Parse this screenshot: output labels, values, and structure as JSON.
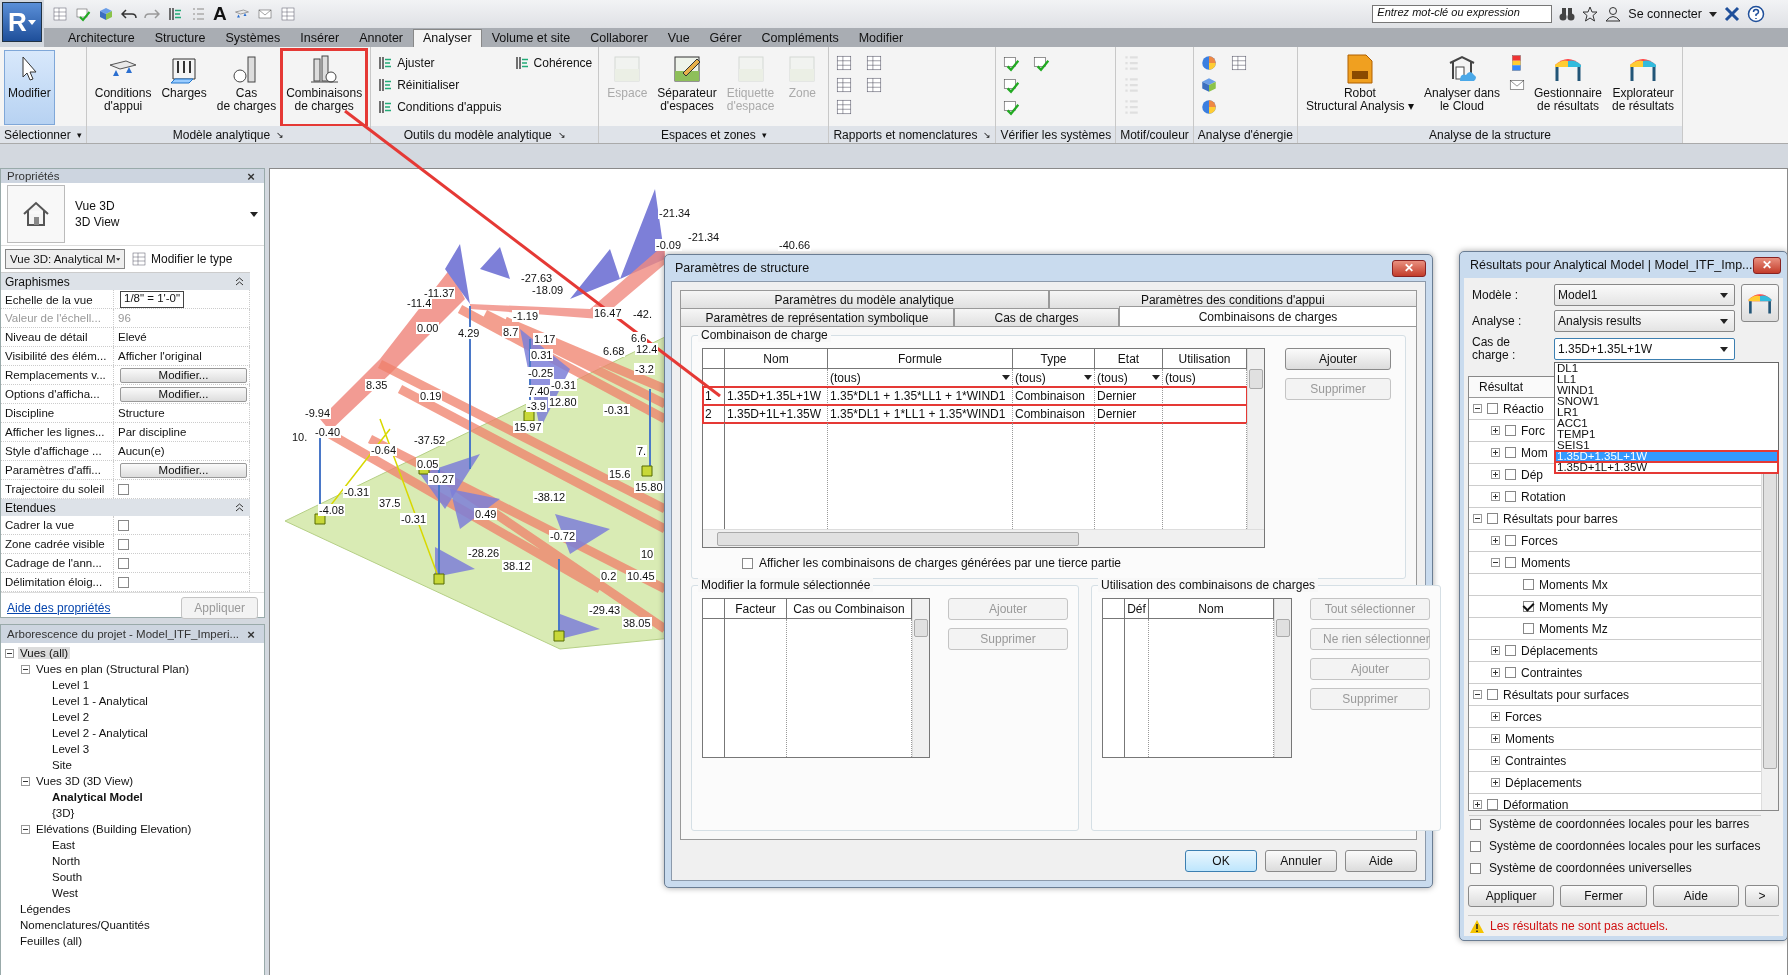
{
  "app": {
    "logo": "R",
    "text_tool": "A",
    "search_placeholder": "Entrez mot-clé ou expression",
    "sign_in": "Se connecter"
  },
  "ribbon_tabs": [
    {
      "label": "Architecture",
      "selected": false
    },
    {
      "label": "Structure",
      "selected": false
    },
    {
      "label": "Systèmes",
      "selected": false
    },
    {
      "label": "Insérer",
      "selected": false
    },
    {
      "label": "Annoter",
      "selected": false
    },
    {
      "label": "Analyser",
      "selected": true
    },
    {
      "label": "Volume et site",
      "selected": false
    },
    {
      "label": "Collaborer",
      "selected": false
    },
    {
      "label": "Vue",
      "selected": false
    },
    {
      "label": "Gérer",
      "selected": false
    },
    {
      "label": "Compléments",
      "selected": false
    },
    {
      "label": "Modifier",
      "selected": false
    }
  ],
  "ribbon_panels": [
    {
      "label": "Sélectionner",
      "launcher": "▾",
      "tools": [
        {
          "kind": "large",
          "label": "Modifier",
          "active": true
        }
      ]
    },
    {
      "label": "Modèle analytique",
      "launcher": "↘",
      "tools": [
        {
          "kind": "large",
          "label": "Conditions\nd'appui"
        },
        {
          "kind": "large",
          "label": "Charges"
        },
        {
          "kind": "large",
          "label": "Cas\nde charges"
        },
        {
          "kind": "large",
          "label": "Combinaisons\nde charges",
          "highlighted": true
        }
      ]
    },
    {
      "label": "Outils du modèle analytique",
      "launcher": "↘",
      "tools": [
        {
          "kind": "small",
          "label": "Ajuster"
        },
        {
          "kind": "small",
          "label": "Réinitialiser"
        },
        {
          "kind": "small",
          "label": "Conditions d'appuis"
        },
        {
          "kind": "small",
          "label": "Cohérence"
        }
      ]
    },
    {
      "label": "Espaces et zones",
      "launcher": "▾",
      "tools": [
        {
          "kind": "large",
          "label": "Espace",
          "disabled": true
        },
        {
          "kind": "large",
          "label": "Séparateur\nd'espaces",
          "disabled": false
        },
        {
          "kind": "large",
          "label": "Etiquette\nd'espace",
          "disabled": true
        },
        {
          "kind": "large",
          "label": "Zone",
          "disabled": true
        }
      ]
    },
    {
      "label": "Rapports et nomenclatures",
      "launcher": "↘",
      "tools": [
        {
          "kind": "icon"
        },
        {
          "kind": "icon"
        },
        {
          "kind": "icon"
        },
        {
          "kind": "icon"
        },
        {
          "kind": "icon"
        }
      ]
    },
    {
      "label": "Vérifier les systèmes",
      "tools": [
        {
          "kind": "icon"
        },
        {
          "kind": "icon"
        },
        {
          "kind": "icon"
        },
        {
          "kind": "icon"
        }
      ]
    },
    {
      "label": "Motif/couleur",
      "tools": [
        {
          "kind": "icon",
          "disabled": true
        },
        {
          "kind": "icon",
          "disabled": true
        },
        {
          "kind": "icon",
          "disabled": true
        }
      ]
    },
    {
      "label": "Analyse d'énergie",
      "tools": [
        {
          "kind": "icon"
        },
        {
          "kind": "icon"
        },
        {
          "kind": "icon"
        },
        {
          "kind": "icon"
        }
      ]
    },
    {
      "label": "Analyse de la structure",
      "tools": [
        {
          "kind": "large",
          "label": "Robot\nStructural Analysis",
          "menu": "▾"
        },
        {
          "kind": "large",
          "label": "Analyser dans\nle Cloud"
        },
        {
          "kind": "icon"
        },
        {
          "kind": "icon"
        },
        {
          "kind": "large",
          "label": "Gestionnaire\nde résultats"
        },
        {
          "kind": "large",
          "label": "Explorateur\nde résultats"
        }
      ]
    }
  ],
  "properties": {
    "title": "Propriétés",
    "close": "×",
    "type_name": "Vue 3D",
    "type_subname": "3D View",
    "view_selector": "Vue 3D: Analytical M",
    "edit_type": "Modifier le type",
    "sections": [
      {
        "title": "Graphismes",
        "expanded": true,
        "rows": [
          {
            "label": "Echelle de la vue",
            "kind": "input",
            "value": "1/8\" = 1'-0\""
          },
          {
            "label": "Valeur de l'échell...",
            "kind": "text",
            "value": "96",
            "disabled": true
          },
          {
            "label": "Niveau de détail",
            "kind": "text",
            "value": "Elevé"
          },
          {
            "label": "Visibilité des élém...",
            "kind": "text",
            "value": "Afficher l'original"
          },
          {
            "label": "Remplacements v...",
            "kind": "button",
            "value": "Modifier..."
          },
          {
            "label": "Options d'afficha...",
            "kind": "button",
            "value": "Modifier..."
          },
          {
            "label": "Discipline",
            "kind": "text",
            "value": "Structure"
          },
          {
            "label": "Afficher les lignes...",
            "kind": "text",
            "value": "Par discipline"
          },
          {
            "label": "Style d'affichage ...",
            "kind": "text",
            "value": "Aucun(e)"
          },
          {
            "label": "Paramètres d'affi...",
            "kind": "button",
            "value": "Modifier..."
          },
          {
            "label": "Trajectoire du soleil",
            "kind": "checkbox",
            "checked": false
          }
        ]
      },
      {
        "title": "Etendues",
        "expanded": true,
        "rows": [
          {
            "label": "Cadrer la vue",
            "kind": "checkbox",
            "checked": false
          },
          {
            "label": "Zone cadrée visible",
            "kind": "checkbox",
            "checked": false
          },
          {
            "label": "Cadrage de l'ann...",
            "kind": "checkbox",
            "checked": false
          },
          {
            "label": "Délimitation éloig...",
            "kind": "checkbox",
            "checked": false
          }
        ]
      }
    ],
    "help_link": "Aide des propriétés",
    "apply": {
      "label": "Appliquer",
      "disabled": true
    }
  },
  "project_browser": {
    "title": "Arborescence du projet - Model_ITF_Imperi...",
    "close": "×",
    "tree": [
      {
        "label": "Vues (all)",
        "expanded": true,
        "selected": true,
        "children": [
          {
            "label": "Vues en plan (Structural Plan)",
            "expanded": true,
            "selected": false,
            "children": [
              {
                "label": "Level 1",
                "selected": false
              },
              {
                "label": "Level 1 - Analytical",
                "selected": false
              },
              {
                "label": "Level 2",
                "selected": false
              },
              {
                "label": "Level 2 - Analytical",
                "selected": false
              },
              {
                "label": "Level 3",
                "selected": false
              },
              {
                "label": "Site",
                "selected": false
              }
            ]
          },
          {
            "label": "Vues 3D (3D View)",
            "expanded": true,
            "selected": false,
            "children": [
              {
                "label": "Analytical Model",
                "selected": false,
                "current": true
              },
              {
                "label": "{3D}",
                "selected": false
              }
            ]
          },
          {
            "label": "Elévations (Building Elevation)",
            "expanded": true,
            "selected": false,
            "children": [
              {
                "label": "East",
                "selected": false
              },
              {
                "label": "North",
                "selected": false
              },
              {
                "label": "South",
                "selected": false
              },
              {
                "label": "West",
                "selected": false
              }
            ]
          }
        ]
      },
      {
        "label": "Légendes",
        "selected": false
      },
      {
        "label": "Nomenclatures/Quantités",
        "selected": false
      },
      {
        "label": "Feuilles (all)",
        "selected": false
      }
    ]
  },
  "model_view": {
    "labels": [
      "-21.34",
      "-0.09",
      "-21.34",
      "-40.66",
      "-11.37",
      "-11.4",
      "-27.63",
      "-18.09",
      "16.47",
      "-42.",
      "0.00",
      "4.29",
      "-1.19",
      "8.7",
      "1.17",
      "6.6",
      "12.4",
      "6.68",
      "0.31",
      "-3.2",
      "-0.25",
      "-0.31",
      "7.40",
      "12.80",
      "-3.9",
      "8.35",
      "0.19",
      "-9.94",
      "10.",
      "-0.40",
      "-0.31",
      "15.97",
      "-37.52",
      "-0.64",
      "0.05",
      "-0.27",
      "7.",
      "15.6",
      "15.80",
      "-0.31",
      "-38.12",
      "-4.08",
      "37.5",
      "-0.31",
      "0.49",
      "-0.72",
      "-28.26",
      "38.12",
      "10",
      "0.2",
      "10.45",
      "-29.43",
      "38.05"
    ]
  },
  "dialog": {
    "title": "Paramètres de structure",
    "close": "✕",
    "tab_rows": [
      [
        {
          "label": "Paramètres du modèle analytique",
          "selected": false
        },
        {
          "label": "Paramètres des conditions d'appui",
          "selected": false
        }
      ],
      [
        {
          "label": "Paramètres de représentation symbolique",
          "selected": false
        },
        {
          "label": "Cas de charges",
          "selected": false
        },
        {
          "label": "Combinaisons de charges",
          "selected": true
        }
      ]
    ],
    "combinations": {
      "title": "Combinaison de charge",
      "columns": [
        "Nom",
        "Formule",
        "Type",
        "Etat",
        "Utilisation"
      ],
      "filters": [
        {
          "value": "(tous)",
          "dropdown": true
        },
        {
          "value": "(tous)",
          "dropdown": true
        },
        {
          "value": "(tous)",
          "dropdown": true
        },
        {
          "value": "(tous)",
          "dropdown": false
        }
      ],
      "rows": [
        {
          "number": "1",
          "name": "1.35D+1.35L+1W",
          "formula": "1.35*DL1 + 1.35*LL1 + 1*WIND1",
          "type": "Combinaison",
          "state": "Dernier",
          "highlighted": true
        },
        {
          "number": "2",
          "name": "1.35D+1L+1.35W",
          "formula": "1.35*DL1 + 1*LL1 + 1.35*WIND1",
          "type": "Combinaison",
          "state": "Dernier",
          "highlighted": true
        }
      ],
      "buttons": [
        {
          "label": "Ajouter",
          "disabled": false
        },
        {
          "label": "Supprimer",
          "disabled": true
        }
      ],
      "third_party": {
        "label": "Afficher les combinaisons de charges générées par une tierce partie",
        "checked": false
      }
    },
    "formula_editor": {
      "title": "Modifier la formule sélectionnée",
      "columns": [
        "Facteur",
        "Cas ou Combinaison"
      ],
      "buttons": [
        {
          "label": "Ajouter",
          "disabled": true
        },
        {
          "label": "Supprimer",
          "disabled": true
        }
      ]
    },
    "usage": {
      "title": "Utilisation des combinaisons de charges",
      "columns": [
        "Déf",
        "Nom"
      ],
      "buttons": [
        {
          "label": "Tout sélectionner",
          "disabled": true
        },
        {
          "label": "Ne rien sélectionner",
          "disabled": true
        },
        {
          "label": "Ajouter",
          "disabled": true
        },
        {
          "label": "Supprimer",
          "disabled": true
        }
      ]
    },
    "footer_buttons": [
      {
        "label": "OK",
        "default": true
      },
      {
        "label": "Annuler",
        "default": false
      },
      {
        "label": "Aide",
        "default": false
      }
    ]
  },
  "results_panel": {
    "title": "Résultats pour Analytical Model | Model_ITF_Imp...",
    "close": "✕",
    "fields": [
      {
        "label": "Modèle :",
        "value": "Model1",
        "open": false
      },
      {
        "label": "Analyse :",
        "value": "Analysis results",
        "open": false
      },
      {
        "label": "Cas de\ncharge :",
        "value": "1.35D+1.35L+1W",
        "open": true
      }
    ],
    "load_case_options": [
      {
        "label": "DL1",
        "selected": false
      },
      {
        "label": "LL1",
        "selected": false
      },
      {
        "label": "WIND1",
        "selected": false
      },
      {
        "label": "SNOW1",
        "selected": false
      },
      {
        "label": "LR1",
        "selected": false
      },
      {
        "label": "ACC1",
        "selected": false
      },
      {
        "label": "TEMP1",
        "selected": false
      },
      {
        "label": "SEIS1",
        "selected": false
      },
      {
        "label": "1.35D+1.35L+1W",
        "selected": true,
        "highlighted": true
      },
      {
        "label": "1.35D+1L+1.35W",
        "selected": false,
        "highlighted": true
      }
    ],
    "tree_header": "Résultat",
    "tree": [
      {
        "label": "Réactio",
        "expanded": true,
        "checked": false,
        "children": [
          {
            "label": "Forc",
            "expanded": false,
            "checked": false
          },
          {
            "label": "Mom",
            "expanded": false,
            "checked": false
          },
          {
            "label": "Dép",
            "expanded": false,
            "checked": false
          },
          {
            "label": "Rotation",
            "expanded": false,
            "checked": false
          }
        ]
      },
      {
        "label": "Résultats pour barres",
        "expanded": true,
        "checked": false,
        "children": [
          {
            "label": "Forces",
            "expanded": false,
            "checked": false
          },
          {
            "label": "Moments",
            "expanded": true,
            "checked": false,
            "children": [
              {
                "label": "Moments Mx",
                "checked": false
              },
              {
                "label": "Moments My",
                "checked": true
              },
              {
                "label": "Moments Mz",
                "checked": false
              }
            ]
          },
          {
            "label": "Déplacements",
            "expanded": false,
            "checked": false
          },
          {
            "label": "Contraintes",
            "expanded": false,
            "checked": false
          }
        ]
      },
      {
        "label": "Résultats pour surfaces",
        "expanded": true,
        "checked": false,
        "children": [
          {
            "label": "Forces",
            "expanded": false
          },
          {
            "label": "Moments",
            "expanded": false
          },
          {
            "label": "Contraintes",
            "expanded": false
          },
          {
            "label": "Déplacements",
            "expanded": false
          }
        ]
      },
      {
        "label": "Déformation",
        "expanded": false,
        "checked": false
      }
    ],
    "options": [
      {
        "label": "Système de coordonnées locales pour les barres",
        "checked": false
      },
      {
        "label": "Système de coordonnées locales pour les surfaces",
        "checked": false
      },
      {
        "label": "Système de coordonnées universelles",
        "checked": false
      }
    ],
    "buttons": [
      "Appliquer",
      "Fermer",
      "Aide",
      ">"
    ],
    "warning": "Les résultats ne sont pas actuels."
  }
}
